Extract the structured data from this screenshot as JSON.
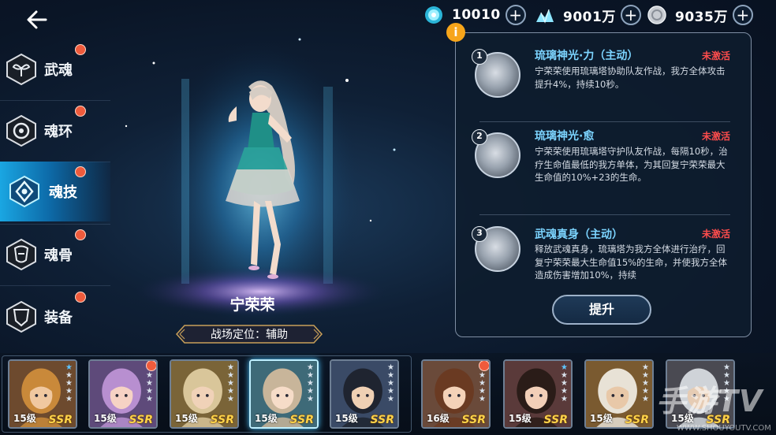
{
  "currencies": [
    {
      "icon": "soul-crystal-icon",
      "value": "10010"
    },
    {
      "icon": "diamond-pile-icon",
      "value": "9001万"
    },
    {
      "icon": "silver-coin-icon",
      "value": "9035万"
    }
  ],
  "plus_symbol": "+",
  "sidebar": {
    "items": [
      {
        "label": "武魂",
        "icon": "sprout-emblem-icon",
        "active": false,
        "dot": true
      },
      {
        "label": "魂环",
        "icon": "ring-emblem-icon",
        "active": false,
        "dot": true
      },
      {
        "label": "魂技",
        "icon": "skill-emblem-icon",
        "active": true,
        "dot": true
      },
      {
        "label": "魂骨",
        "icon": "bone-emblem-icon",
        "active": false,
        "dot": true
      },
      {
        "label": "装备",
        "icon": "equipment-emblem-icon",
        "active": false,
        "dot": true
      }
    ]
  },
  "character": {
    "name": "宁荣荣",
    "role": "战场定位：辅助"
  },
  "info_badge": "i",
  "skills": [
    {
      "num": "1",
      "title": "琉璃神光·力（主动）",
      "status": "未激活",
      "desc": "宁荣荣使用琉璃塔协助队友作战，我方全体攻击提升4%，持续10秒。"
    },
    {
      "num": "2",
      "title": "琉璃神光·愈",
      "status": "未激活",
      "desc": "宁荣荣使用琉璃塔守护队友作战，每隔10秒，治疗生命值最低的我方单体，为其回复宁荣荣最大生命值的10%+23的生命。"
    },
    {
      "num": "3",
      "title": "武魂真身（主动）",
      "status": "未激活",
      "desc": "释放武魂真身，琉璃塔为我方全体进行治疗，回复宁荣荣最大生命值15%的生命，并使我方全体造成伤害增加10%，持续"
    }
  ],
  "upgrade_label": "提升",
  "roster": [
    {
      "level": "15级",
      "rarity": "SSR",
      "stars_blue": 1,
      "selected": false,
      "dot": false,
      "hair": "#c9893a",
      "skin": "#f0c8a0",
      "bg": "#6d4a2e"
    },
    {
      "level": "15级",
      "rarity": "SSR",
      "stars_blue": 0,
      "selected": false,
      "dot": true,
      "hair": "#b88fd0",
      "skin": "#f6d2c4",
      "bg": "#5e4a7a"
    },
    {
      "level": "15级",
      "rarity": "SSR",
      "stars_blue": 0,
      "selected": false,
      "dot": false,
      "hair": "#d9c69a",
      "skin": "#f0d2b8",
      "bg": "#7a6438"
    },
    {
      "level": "15级",
      "rarity": "SSR",
      "stars_blue": 0,
      "selected": true,
      "dot": false,
      "hair": "#c8b59a",
      "skin": "#f6dcc8",
      "bg": "#3e6a78"
    },
    {
      "level": "15级",
      "rarity": "SSR",
      "stars_blue": 0,
      "selected": false,
      "dot": false,
      "hair": "#1f2430",
      "skin": "#efd0b4",
      "bg": "#3a4a66"
    },
    {
      "level": "16级",
      "rarity": "SSR",
      "stars_blue": 0,
      "selected": false,
      "dot": true,
      "hair": "#6a3a22",
      "skin": "#f4d2b8",
      "bg": "#6a4a3a"
    },
    {
      "level": "15级",
      "rarity": "SSR",
      "stars_blue": 1,
      "selected": false,
      "dot": false,
      "hair": "#2a1c18",
      "skin": "#f2cfb8",
      "bg": "#5a3a3a"
    },
    {
      "level": "15级",
      "rarity": "SSR",
      "stars_blue": 0,
      "selected": false,
      "dot": false,
      "hair": "#e8e2d6",
      "skin": "#e8c8a8",
      "bg": "#7a5a30"
    },
    {
      "level": "15级",
      "rarity": "SSR",
      "stars_blue": 0,
      "selected": false,
      "dot": false,
      "hair": "#cfd3d8",
      "skin": "#e6ccb4",
      "bg": "#4a4a52"
    }
  ],
  "watermark": "手游TV",
  "watermark_url": "WWW.SHOUYOUTV.COM"
}
